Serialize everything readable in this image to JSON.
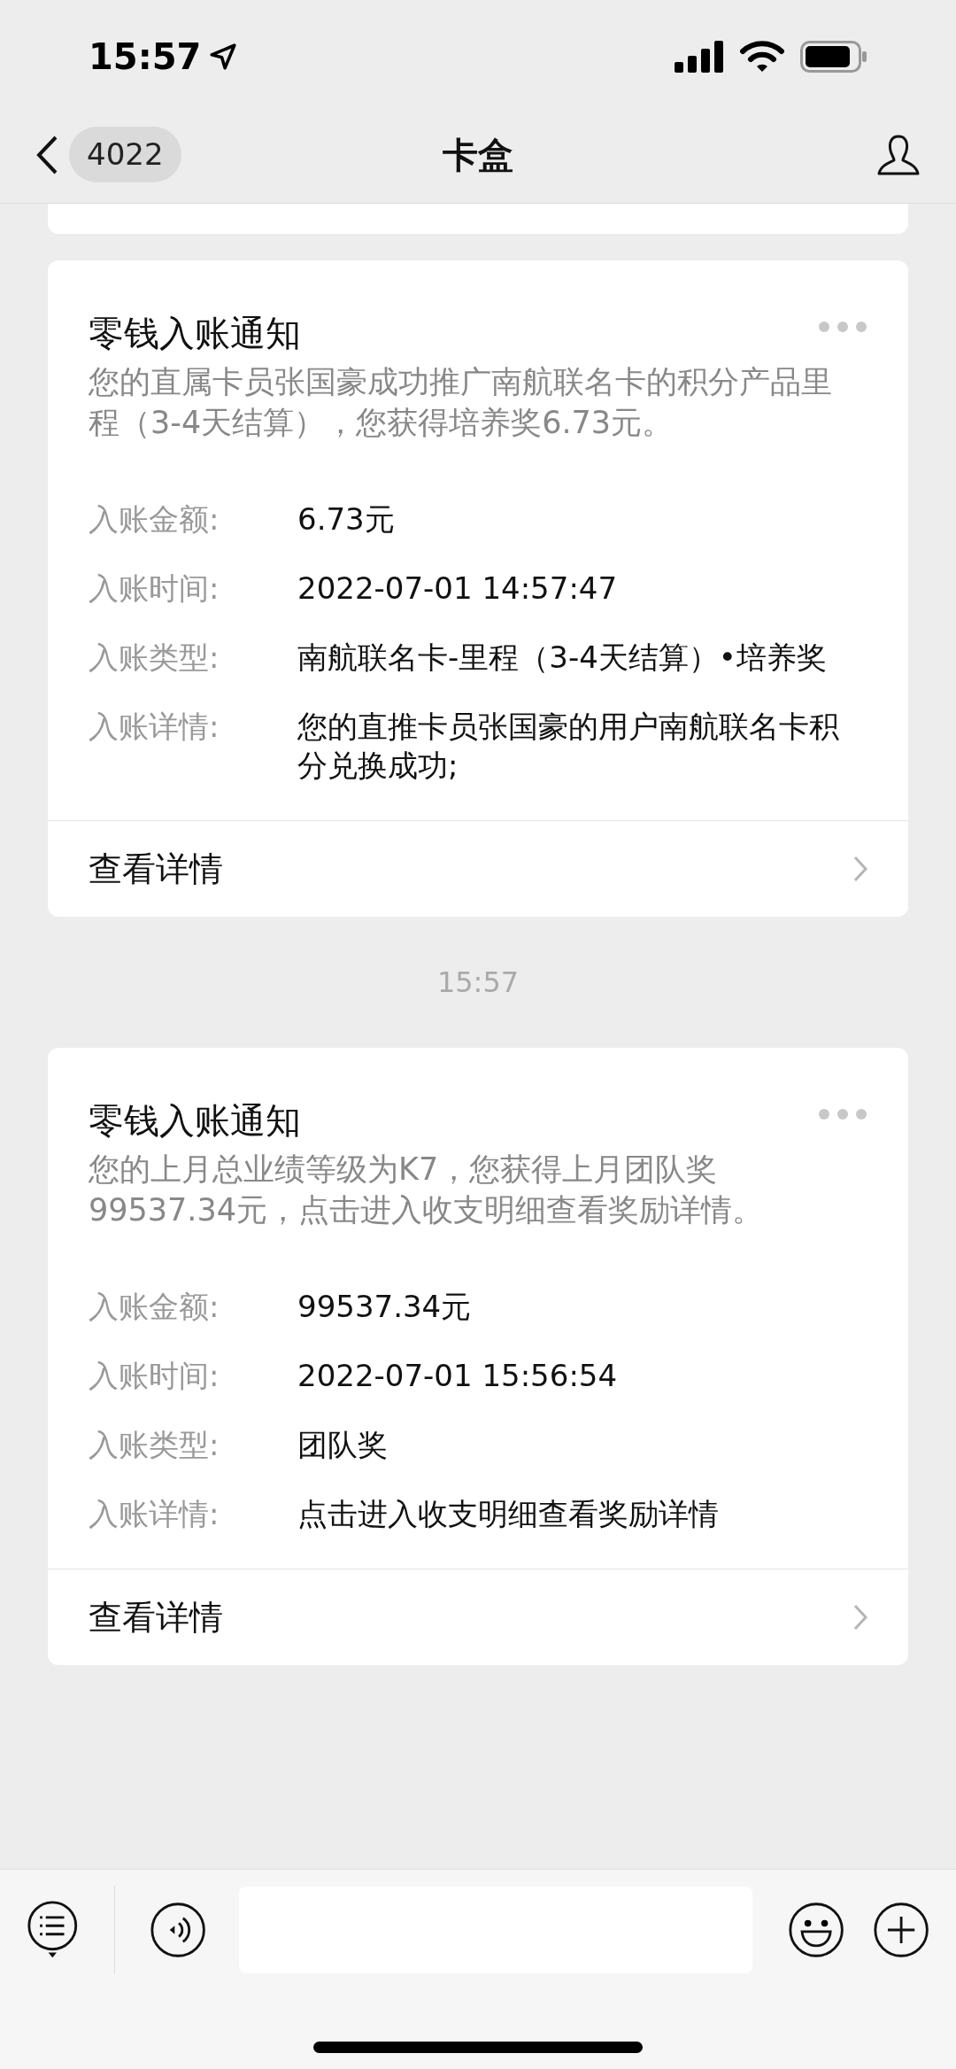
{
  "status_bar": {
    "time": "15:57"
  },
  "nav": {
    "badge": "4022",
    "title": "卡盒"
  },
  "messages": [
    {
      "kind": "card",
      "title": "零钱入账通知",
      "description": "您的直属卡员张国豪成功推广南航联名卡的积分产品里程（3-4天结算），您获得培养奖6.73元。",
      "fields": [
        {
          "label": "入账金额:",
          "value": "6.73元"
        },
        {
          "label": "入账时间:",
          "value": "2022-07-01 14:57:47"
        },
        {
          "label": "入账类型:",
          "value": "南航联名卡-里程（3-4天结算）•培养奖"
        },
        {
          "label": "入账详情:",
          "value": "您的直推卡员张国豪的用户南航联名卡积分兑换成功;"
        }
      ],
      "link": "查看详情"
    },
    {
      "kind": "time",
      "text": "15:57"
    },
    {
      "kind": "card",
      "title": "零钱入账通知",
      "description": "您的上月总业绩等级为K7，您获得上月团队奖99537.34元，点击进入收支明细查看奖励详情。",
      "fields": [
        {
          "label": "入账金额:",
          "value": "99537.34元"
        },
        {
          "label": "入账时间:",
          "value": "2022-07-01 15:56:54"
        },
        {
          "label": "入账类型:",
          "value": "团队奖"
        },
        {
          "label": "入账详情:",
          "value": "点击进入收支明细查看奖励详情"
        }
      ],
      "link": "查看详情"
    }
  ]
}
